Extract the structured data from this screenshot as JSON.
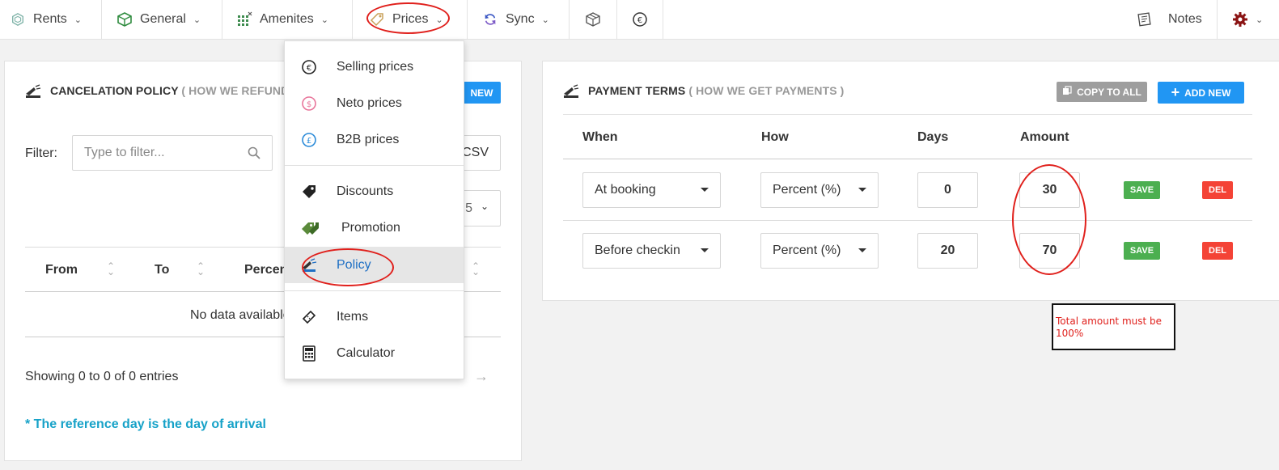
{
  "nav": {
    "rents": "Rents",
    "general": "General",
    "amenites": "Amenites",
    "prices": "Prices",
    "sync": "Sync",
    "notes": "Notes"
  },
  "cancel": {
    "title": "CANCELATION POLICY",
    "subtitle": "( HOW WE REFUND",
    "new_label": "NEW",
    "filter_label": "Filter:",
    "filter_placeholder": "Type to filter...",
    "csv_label": "CSV",
    "page_size_partial": "5",
    "columns": [
      "From",
      "To",
      "Percen"
    ],
    "no_data": "No data available",
    "showing": "Showing 0 to 0 of 0 entries",
    "next_arrow": "→",
    "note": "* The reference day is the day of arrival"
  },
  "prices_menu": {
    "items": [
      {
        "label": "Selling prices",
        "icon": "euro-circle-icon"
      },
      {
        "label": "Neto prices",
        "icon": "dollar-circle-icon"
      },
      {
        "label": "B2B prices",
        "icon": "pound-circle-icon"
      },
      {
        "label": "Discounts",
        "icon": "tag-icon"
      },
      {
        "label": "Promotion",
        "icon": "tags-icon"
      },
      {
        "label": "Policy",
        "icon": "policy-icon"
      },
      {
        "label": "Items",
        "icon": "ticket-icon"
      },
      {
        "label": "Calculator",
        "icon": "calculator-icon"
      }
    ],
    "active": "Policy"
  },
  "payment": {
    "title": "PAYMENT TERMS",
    "subtitle": "( HOW WE GET PAYMENTS )",
    "copy_all": "COPY TO ALL",
    "add_new": "ADD NEW",
    "columns": [
      "When",
      "How",
      "Days",
      "Amount"
    ],
    "rows": [
      {
        "when": "At booking",
        "how": "Percent (%)",
        "days": "0",
        "amount": "30",
        "save": "SAVE",
        "del": "DEL"
      },
      {
        "when": "Before checkin",
        "how": "Percent (%)",
        "days": "20",
        "amount": "70",
        "save": "SAVE",
        "del": "DEL"
      }
    ]
  },
  "annotation": {
    "text": "Total amount must be 100%",
    "color": "#e0201c"
  },
  "colors": {
    "accent": "#2196f3",
    "note": "#17a2c8",
    "save": "#4caf50",
    "del": "#f44336"
  }
}
